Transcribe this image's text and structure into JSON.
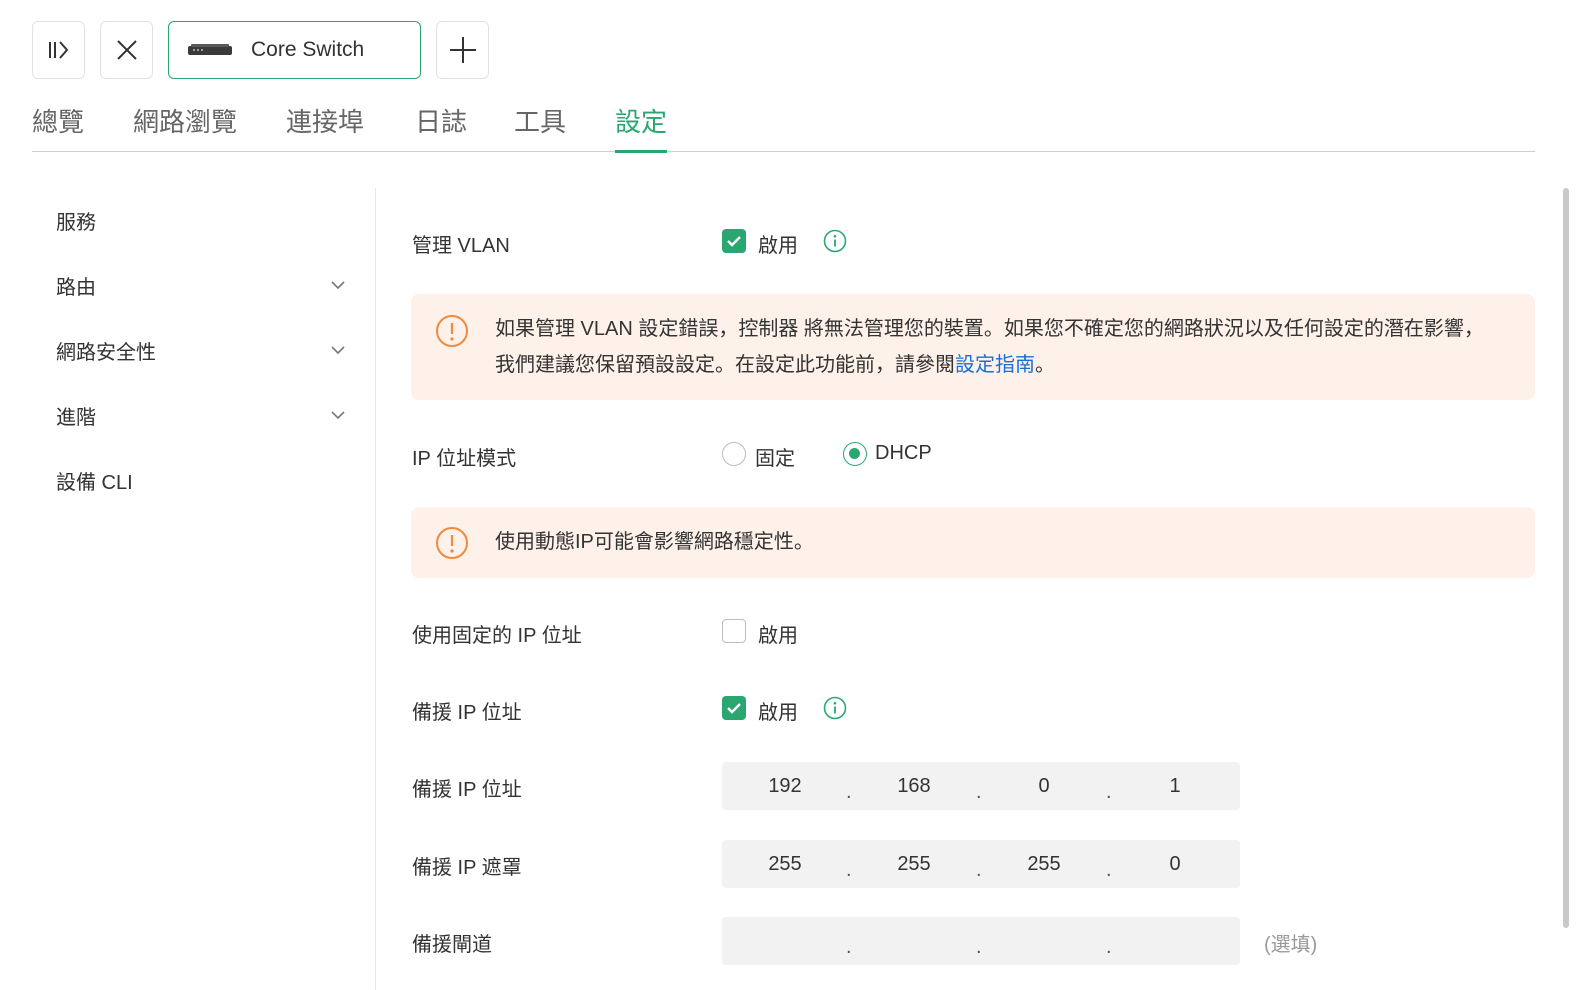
{
  "toolbar": {
    "collapse_icon": "collapse-panel-icon",
    "close_icon": "close-icon",
    "device_tab": {
      "label": "Core Switch",
      "icon": "switch-device-icon"
    },
    "add_icon": "plus-icon"
  },
  "tabs": [
    {
      "label": "總覽",
      "active": false
    },
    {
      "label": "網路瀏覽",
      "active": false
    },
    {
      "label": "連接埠",
      "active": false
    },
    {
      "label": "日誌",
      "active": false
    },
    {
      "label": "工具",
      "active": false
    },
    {
      "label": "設定",
      "active": true
    }
  ],
  "sidebar": {
    "items": [
      {
        "label": "服務",
        "expandable": false
      },
      {
        "label": "路由",
        "expandable": true
      },
      {
        "label": "網路安全性",
        "expandable": true
      },
      {
        "label": "進階",
        "expandable": true
      },
      {
        "label": "設備 CLI",
        "expandable": false
      }
    ]
  },
  "settings": {
    "mgmt_vlan": {
      "label": "管理 VLAN",
      "checkbox_label": "啟用",
      "checked": true
    },
    "warning1": {
      "line1": "如果管理 VLAN 設定錯誤，控制器 將無法管理您的裝置。如果您不確定您的網路狀況以及任何設定的潛在影響，",
      "line2_prefix": "我們建議您保留預設設定。在設定此功能前，請參閱",
      "link": "設定指南",
      "line2_suffix": "。"
    },
    "ip_mode": {
      "label": "IP 位址模式",
      "option_static": "固定",
      "option_dhcp": "DHCP",
      "selected": "DHCP"
    },
    "warning2": {
      "text": "使用動態IP可能會影響網路穩定性。"
    },
    "fixed_ip": {
      "label": "使用固定的 IP 位址",
      "checkbox_label": "啟用",
      "checked": false
    },
    "fallback": {
      "label": "備援 IP 位址",
      "checkbox_label": "啟用",
      "checked": true
    },
    "fallback_ip": {
      "label": "備援 IP 位址",
      "octets": [
        "192",
        "168",
        "0",
        "1"
      ]
    },
    "fallback_mask": {
      "label": "備援 IP 遮罩",
      "octets": [
        "255",
        "255",
        "255",
        "0"
      ]
    },
    "fallback_gateway": {
      "label": "備援閘道",
      "octets": [
        "",
        "",
        "",
        ""
      ],
      "optional": "(選填)"
    }
  },
  "colors": {
    "accent": "#2aa671",
    "warning": "#f08a3c",
    "warning_bg": "#fdf1ea",
    "link": "#1a6fd1"
  }
}
